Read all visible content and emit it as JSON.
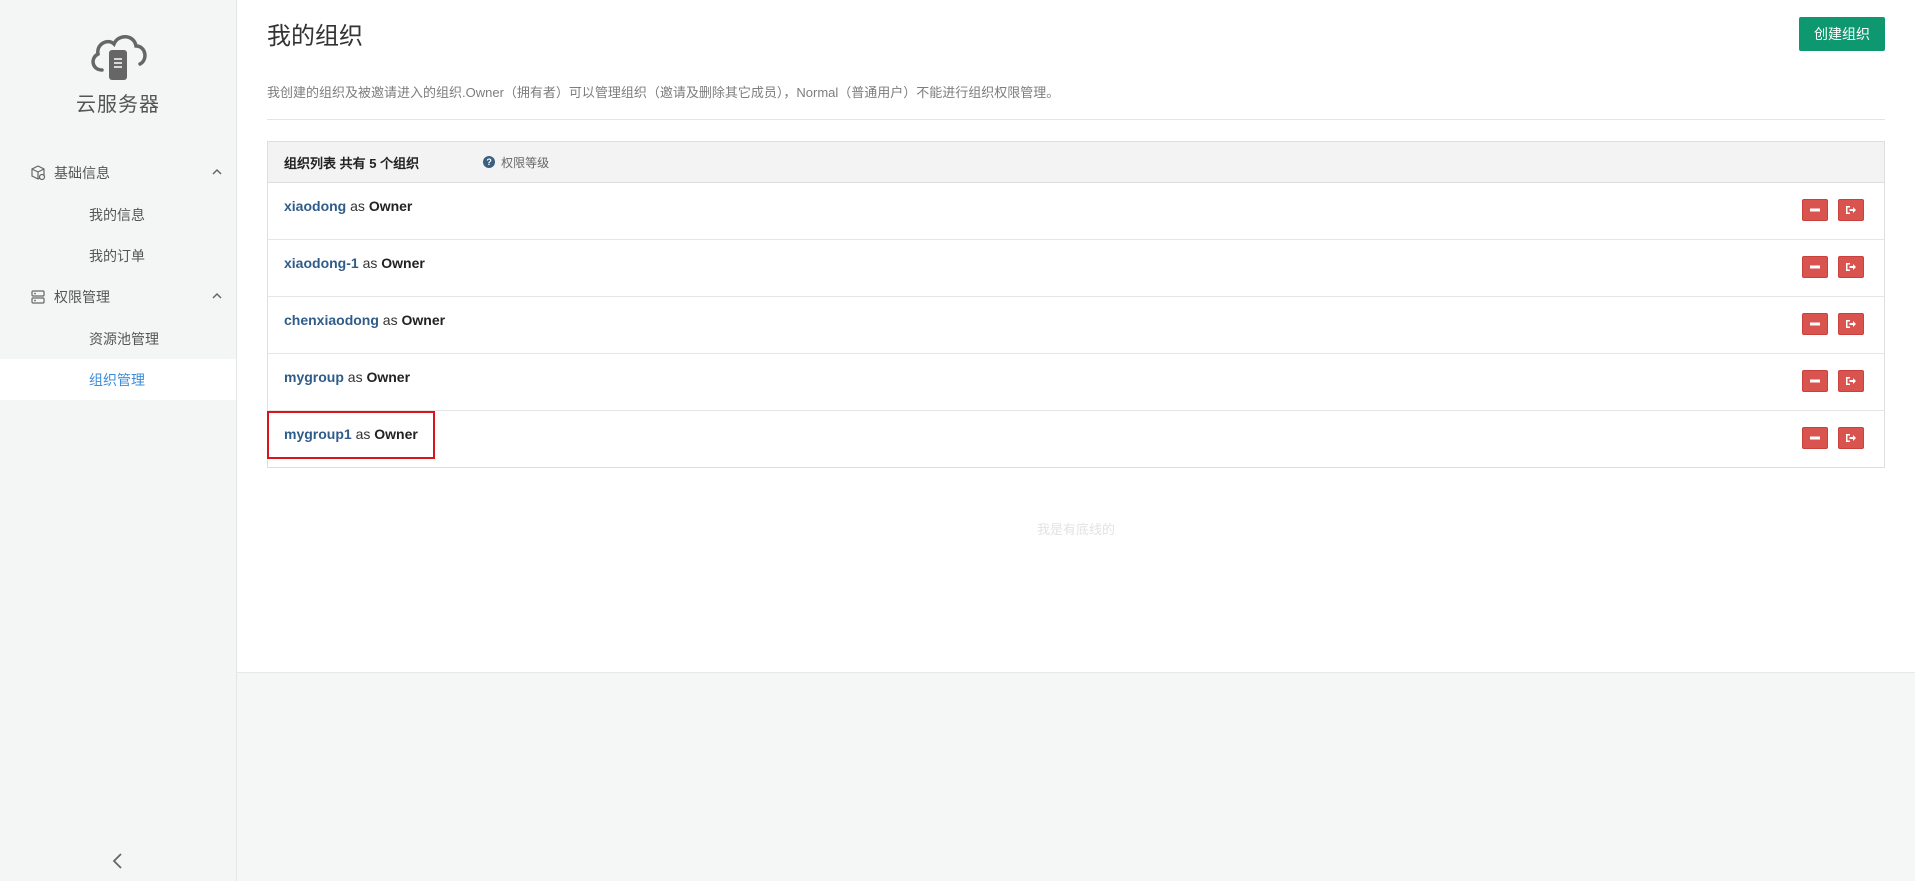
{
  "sidebar": {
    "brand": "云服务器",
    "groups": [
      {
        "label": "基础信息",
        "icon": "cube-icon",
        "items": [
          {
            "label": "我的信息"
          },
          {
            "label": "我的订单"
          }
        ]
      },
      {
        "label": "权限管理",
        "icon": "server-icon",
        "items": [
          {
            "label": "资源池管理"
          },
          {
            "label": "组织管理",
            "active": true
          }
        ]
      }
    ]
  },
  "header": {
    "title": "我的组织",
    "create_button": "创建组织",
    "description": "我创建的组织及被邀请进入的组织.Owner（拥有者）可以管理组织（邀请及删除其它成员），Normal（普通用户）不能进行组织权限管理。"
  },
  "panel": {
    "title": "组织列表 共有 5 个组织",
    "perm_link": "权限等级",
    "rows": [
      {
        "name": "xiaodong",
        "as": "as",
        "role": "Owner"
      },
      {
        "name": "xiaodong-1",
        "as": "as",
        "role": "Owner"
      },
      {
        "name": "chenxiaodong",
        "as": "as",
        "role": "Owner"
      },
      {
        "name": "mygroup",
        "as": "as",
        "role": "Owner"
      },
      {
        "name": "mygroup1",
        "as": "as",
        "role": "Owner"
      }
    ]
  },
  "footer_note": "我是有底线的",
  "colors": {
    "accent": "#0e9870",
    "danger": "#d9534f",
    "link": "#2f5c8a",
    "active_nav": "#3c8dd9",
    "highlight": "#d9141a"
  }
}
